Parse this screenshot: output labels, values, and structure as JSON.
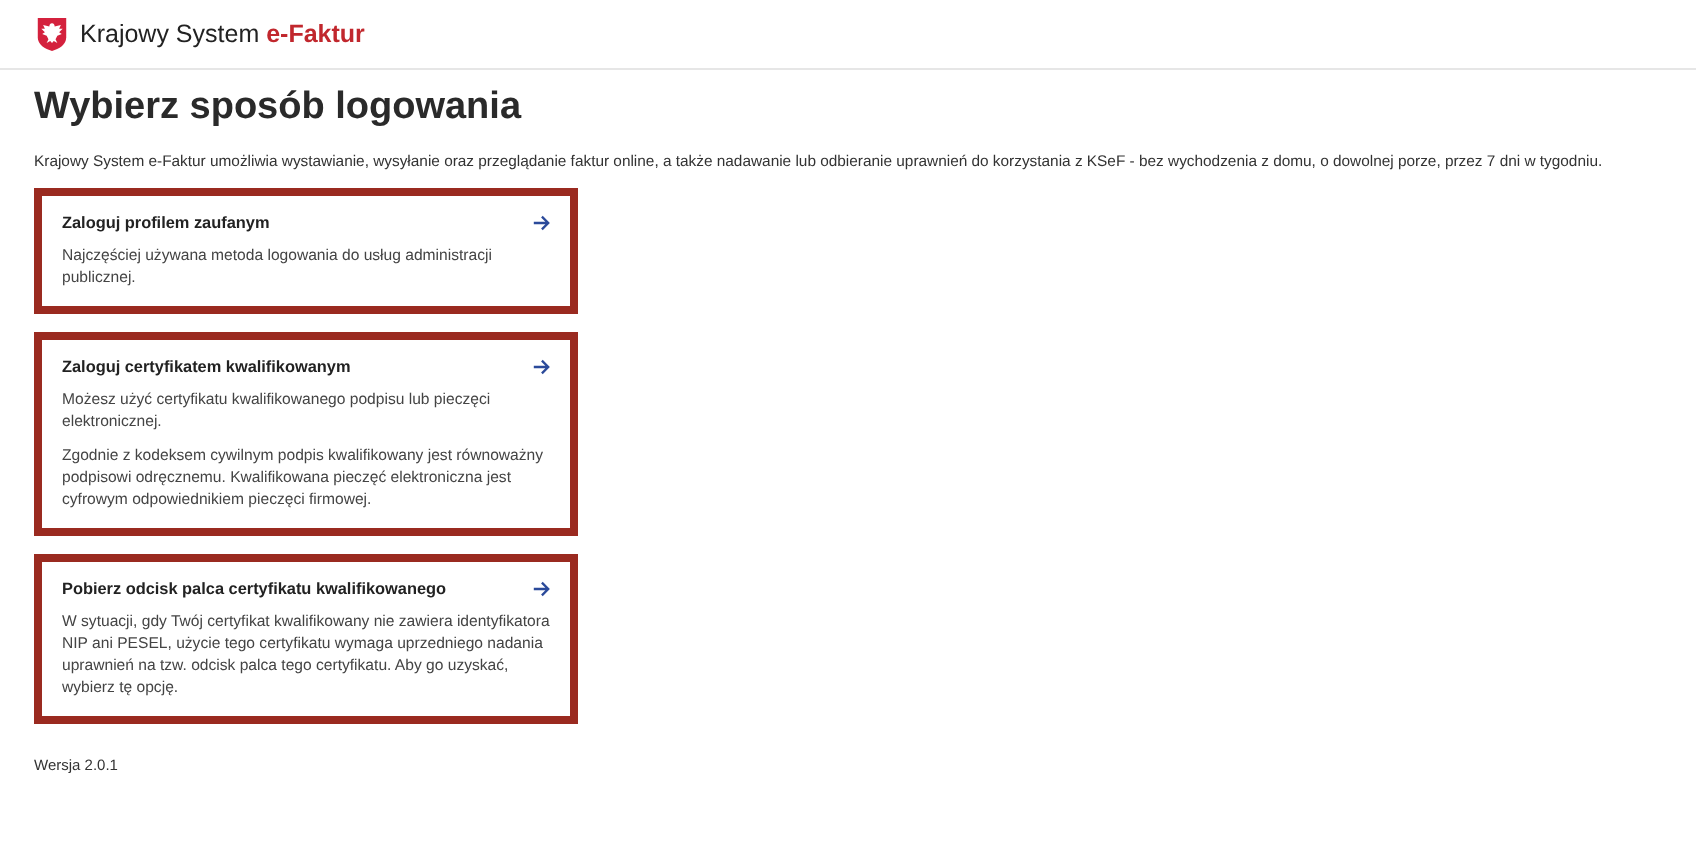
{
  "header": {
    "brand": "Krajowy System",
    "brand_accent": "e-Faktur"
  },
  "title": "Wybierz sposób logowania",
  "intro": "Krajowy System e-Faktur umożliwia wystawianie, wysyłanie oraz przeglądanie faktur online, a także nadawanie lub odbieranie uprawnień do korzystania z KSeF - bez wychodzenia z domu, o dowolnej porze, przez 7 dni w tygodniu.",
  "options": [
    {
      "title": "Zaloguj profilem zaufanym",
      "paragraphs": [
        "Najczęściej używana metoda logowania do usług administracji publicznej."
      ]
    },
    {
      "title": "Zaloguj certyfikatem kwalifikowanym",
      "paragraphs": [
        "Możesz użyć certyfikatu kwalifikowanego podpisu lub pieczęci elektronicznej.",
        "Zgodnie z kodeksem cywilnym podpis kwalifikowany jest równoważny podpisowi odręcznemu. Kwalifikowana pieczęć elektroniczna jest cyfrowym odpowiednikiem pieczęci firmowej."
      ]
    },
    {
      "title": "Pobierz odcisk palca certyfikatu kwalifikowanego",
      "paragraphs": [
        "W sytuacji, gdy Twój certyfikat kwalifikowany nie zawiera identyfikatora NIP ani PESEL, użycie tego certyfikatu wymaga uprzedniego nadania uprawnień na tzw. odcisk palca tego certyfikatu. Aby go uzyskać, wybierz tę opcję."
      ]
    }
  ],
  "version": "Wersja 2.0.1"
}
